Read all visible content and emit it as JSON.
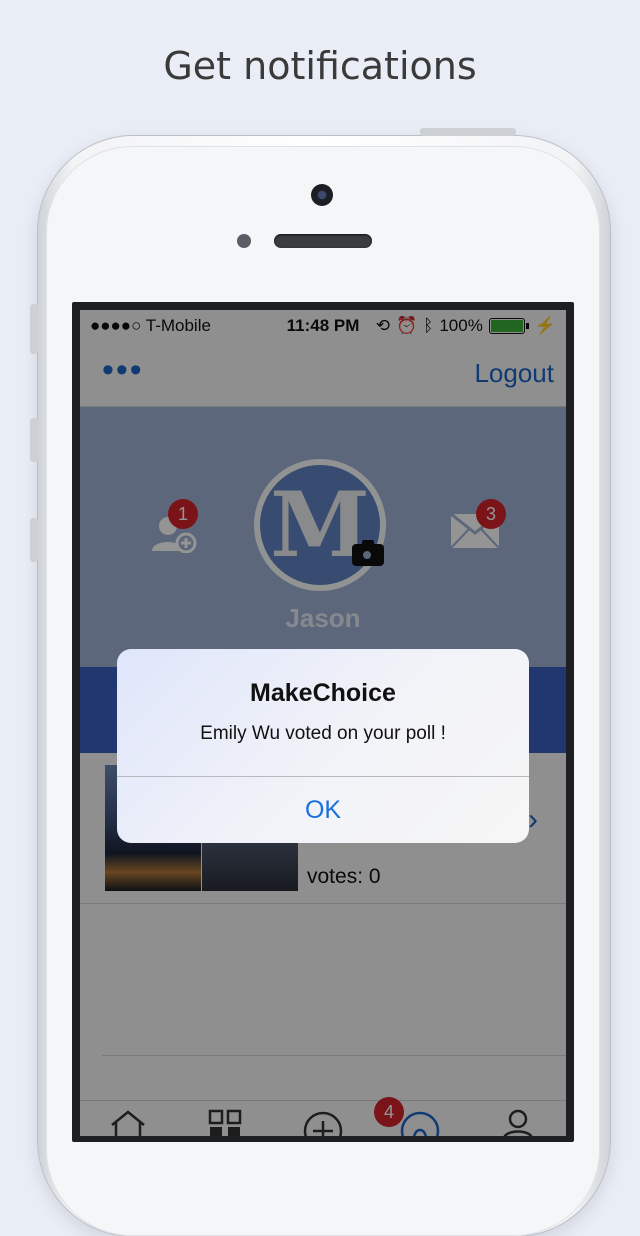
{
  "headline": "Get notifications",
  "status_bar": {
    "carrier": "●●●●○ T-Mobile",
    "time": "11:48 PM",
    "battery": "100%"
  },
  "nav": {
    "more_icon": "ellipsis-icon",
    "logout_label": "Logout"
  },
  "profile": {
    "username": "Jason",
    "avatar_letter": "M",
    "friend_requests_badge": "1",
    "messages_badge": "3"
  },
  "poll": {
    "votes_label": "votes:  0",
    "chevron": "›"
  },
  "tabbar": {
    "notifications_badge": "4",
    "tabs": [
      "home-icon",
      "qr-code-icon",
      "add-icon",
      "notifications-icon",
      "profile-icon"
    ]
  },
  "alert": {
    "title": "MakeChoice",
    "message": "Emily Wu voted on your poll !",
    "ok_label": "OK"
  },
  "colors": {
    "accent": "#1a64c4",
    "profile_bg": "#9fb1d4",
    "band": "#3b5fc2",
    "badge": "#d3242b"
  }
}
